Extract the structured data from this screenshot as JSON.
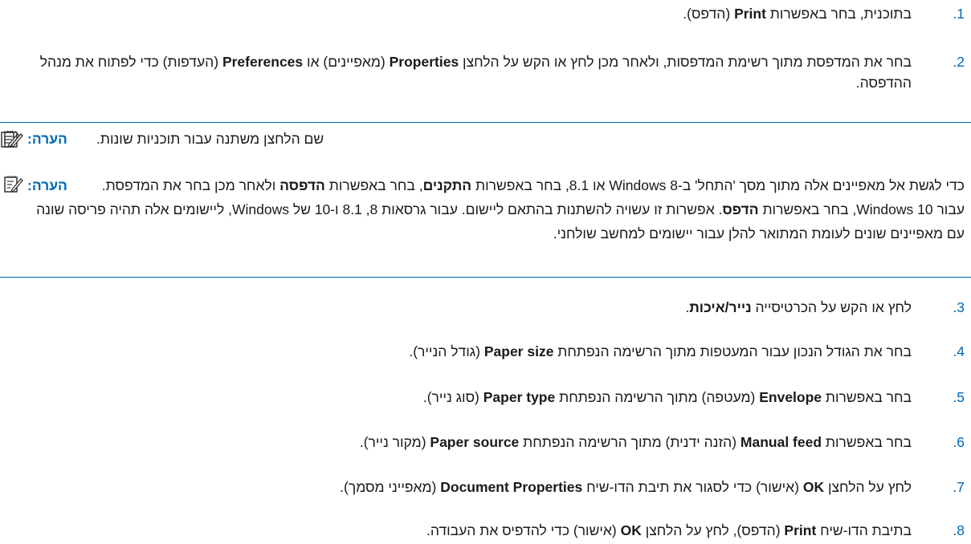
{
  "steps": [
    {
      "num": "1.",
      "html": "בתוכנית, בחר באפשרות <b>Print</b> (הדפס)."
    },
    {
      "num": "2.",
      "html": "בחר את המדפסת מתוך רשימת המדפסות, ולאחר מכן לחץ או הקש על הלחצן <b>Properties</b> (מאפיינים) או <b>Preferences</b> (העדפות) כדי לפתוח את מנהל ההדפסה."
    },
    {
      "num": "3.",
      "html": "לחץ או הקש על הכרטיסייה <b>נייר/איכות</b>."
    },
    {
      "num": "4.",
      "html": "בחר את הגודל הנכון עבור המעטפות מתוך הרשימה הנפתחת <b>Paper size</b> (גודל הנייר)."
    },
    {
      "num": "5.",
      "html": "בחר באפשרות <b>Envelope</b> (מעטפה) מתוך הרשימה הנפתחת <b>Paper type</b> (סוג נייר)."
    },
    {
      "num": "6.",
      "html": "בחר באפשרות <b>Manual feed</b> (הזנה ידנית) מתוך הרשימה הנפתחת <b>Paper source</b> (מקור נייר)."
    },
    {
      "num": "7.",
      "html": "לחץ על הלחצן <b>OK</b> (אישור) כדי לסגור את תיבת הדו-שיח <b>Document Properties</b> (מאפייני מסמך)."
    },
    {
      "num": "8.",
      "html": "בתיבת הדו-שיח <b>Print</b> (הדפס), לחץ על הלחצן <b>OK</b> (אישור) כדי להדפיס את העבודה."
    }
  ],
  "notes": [
    {
      "label": "הערה:",
      "text": "שם הלחצן משתנה עבור תוכניות שונות.",
      "icon": "note-icon"
    },
    {
      "label": "הערה:",
      "html": "כדי לגשת אל מאפיינים אלה מתוך מסך 'התחל' ב-Windows 8 או 8.1, בחר באפשרות <b>התקנים</b>, בחר באפשרות <b>הדפסה</b> ולאחר מכן בחר את המדפסת. עבור Windows 10, בחר באפשרות <b>הדפס</b>. אפשרות זו עשויה להשתנות בהתאם ליישום. עבור גרסאות 8, 8.1 ו-10 של Windows, ליישומים אלה תהיה פריסה שונה עם מאפיינים שונים לעומת המתואר להלן עבור יישומים למחשב שולחני.",
      "icon": "note-icon"
    }
  ],
  "colors": {
    "accent": "#0067b4",
    "text": "#1a1a1a"
  }
}
